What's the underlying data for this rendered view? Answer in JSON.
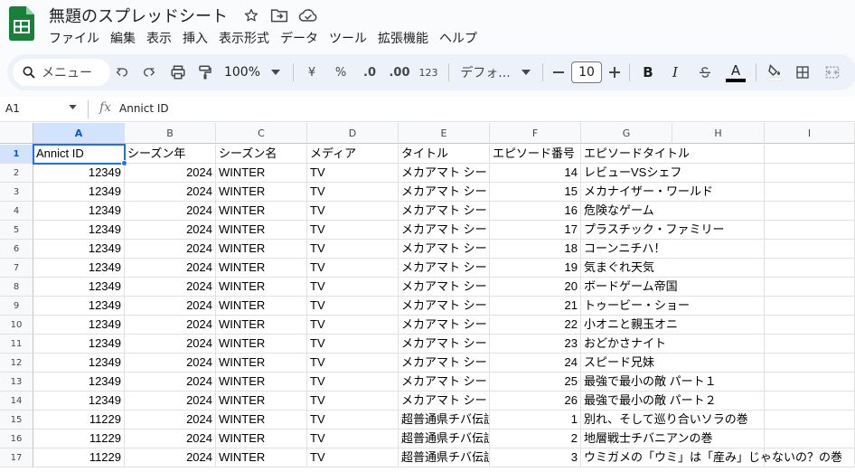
{
  "app": {
    "doc_title": "無題のスプレッドシート",
    "menus": [
      "ファイル",
      "編集",
      "表示",
      "挿入",
      "表示形式",
      "データ",
      "ツール",
      "拡張機能",
      "ヘルプ"
    ]
  },
  "toolbar": {
    "search_label": "メニュー",
    "zoom": "100%",
    "currency": "¥",
    "percent": "%",
    "decimal_decrease": ".0",
    "decimal_increase": ".00",
    "number_format": "123",
    "font_name": "デフォ...",
    "font_size": "10",
    "bold": "B",
    "italic": "I",
    "text_color_letter": "A"
  },
  "formula_bar": {
    "name_box": "A1",
    "fx": "fx",
    "content": "Annict ID"
  },
  "sheet": {
    "columns": [
      "A",
      "B",
      "C",
      "D",
      "E",
      "F",
      "G",
      "H",
      "I"
    ],
    "rows": [
      {
        "n": "1",
        "a": "Annict ID",
        "b": "シーズン年",
        "c": "シーズン名",
        "d": "メディア",
        "e": "タイトル",
        "f": "エピソード番号",
        "g": "エピソードタイトル"
      },
      {
        "n": "2",
        "a": "12349",
        "b": "2024",
        "c": "WINTER",
        "d": "TV",
        "e": "メカアマト シー",
        "f": "14",
        "g": "レビューVSシェフ"
      },
      {
        "n": "3",
        "a": "12349",
        "b": "2024",
        "c": "WINTER",
        "d": "TV",
        "e": "メカアマト シー",
        "f": "15",
        "g": "メカナイザー・ワールド"
      },
      {
        "n": "4",
        "a": "12349",
        "b": "2024",
        "c": "WINTER",
        "d": "TV",
        "e": "メカアマト シー",
        "f": "16",
        "g": "危険なゲーム"
      },
      {
        "n": "5",
        "a": "12349",
        "b": "2024",
        "c": "WINTER",
        "d": "TV",
        "e": "メカアマト シー",
        "f": "17",
        "g": "プラスチック・ファミリー"
      },
      {
        "n": "6",
        "a": "12349",
        "b": "2024",
        "c": "WINTER",
        "d": "TV",
        "e": "メカアマト シー",
        "f": "18",
        "g": "コーンニチハ！"
      },
      {
        "n": "7",
        "a": "12349",
        "b": "2024",
        "c": "WINTER",
        "d": "TV",
        "e": "メカアマト シー",
        "f": "19",
        "g": "気まぐれ天気"
      },
      {
        "n": "8",
        "a": "12349",
        "b": "2024",
        "c": "WINTER",
        "d": "TV",
        "e": "メカアマト シー",
        "f": "20",
        "g": "ボードゲーム帝国"
      },
      {
        "n": "9",
        "a": "12349",
        "b": "2024",
        "c": "WINTER",
        "d": "TV",
        "e": "メカアマト シー",
        "f": "21",
        "g": "トゥービー・ショー"
      },
      {
        "n": "10",
        "a": "12349",
        "b": "2024",
        "c": "WINTER",
        "d": "TV",
        "e": "メカアマト シー",
        "f": "22",
        "g": "小オニと親玉オニ"
      },
      {
        "n": "11",
        "a": "12349",
        "b": "2024",
        "c": "WINTER",
        "d": "TV",
        "e": "メカアマト シー",
        "f": "23",
        "g": "おどかさナイト"
      },
      {
        "n": "12",
        "a": "12349",
        "b": "2024",
        "c": "WINTER",
        "d": "TV",
        "e": "メカアマト シー",
        "f": "24",
        "g": "スピード兄妹"
      },
      {
        "n": "13",
        "a": "12349",
        "b": "2024",
        "c": "WINTER",
        "d": "TV",
        "e": "メカアマト シー",
        "f": "25",
        "g": "最強で最小の敵 パート１"
      },
      {
        "n": "14",
        "a": "12349",
        "b": "2024",
        "c": "WINTER",
        "d": "TV",
        "e": "メカアマト シー",
        "f": "26",
        "g": "最強で最小の敵 パート２"
      },
      {
        "n": "15",
        "a": "11229",
        "b": "2024",
        "c": "WINTER",
        "d": "TV",
        "e": "超普通県チバ伝説",
        "f": "1",
        "g": "別れ、そして巡り合いソラの巻"
      },
      {
        "n": "16",
        "a": "11229",
        "b": "2024",
        "c": "WINTER",
        "d": "TV",
        "e": "超普通県チバ伝説",
        "f": "2",
        "g": "地層戦士チバニアンの巻"
      },
      {
        "n": "17",
        "a": "11229",
        "b": "2024",
        "c": "WINTER",
        "d": "TV",
        "e": "超普通県チバ伝説",
        "f": "3",
        "g": "ウミガメの「ウミ」は「産み」じゃないの？の巻"
      }
    ]
  },
  "colors": {
    "accent": "#1a73e8",
    "selected_header": "#d3e3fd",
    "sheets_green": "#188038"
  }
}
